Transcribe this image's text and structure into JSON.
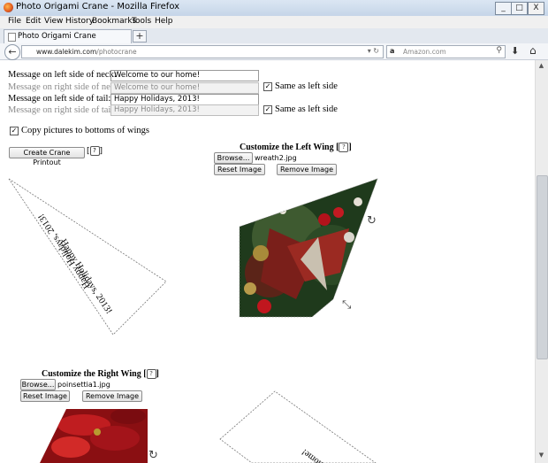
{
  "window": {
    "title": "Photo Origami Crane - Mozilla Firefox",
    "buttons": [
      "_",
      "□",
      "X"
    ]
  },
  "menu": [
    "File",
    "Edit",
    "View",
    "History",
    "Bookmarks",
    "Tools",
    "Help"
  ],
  "tab": {
    "label": "Photo Origami Crane",
    "new_tab": "+"
  },
  "nav": {
    "url_host": "www.dalekim.com",
    "url_path": "/photocrane",
    "search_placeholder": "Amazon.com"
  },
  "form": {
    "neck_left_label": "Message on left side of neck:",
    "neck_left_value": "Welcome to our home!",
    "neck_right_label": "Message on right side of neck:",
    "neck_right_value": "Welcome to our home!",
    "neck_same_label": "Same as left side",
    "tail_left_label": "Message on left side of tail:",
    "tail_left_value": "Happy Holidays, 2013!",
    "tail_right_label": "Message on right side of tail:",
    "tail_right_value": "Happy Holidays, 2013!",
    "tail_same_label": "Same as left side",
    "copy_label": "Copy pictures to bottoms of wings",
    "printout_button": "Create Crane Printout",
    "help_glyph": "?"
  },
  "left_wing": {
    "title": "Customize the Left Wing",
    "browse": "Browse...",
    "filename": "wreath2.jpg",
    "reset": "Reset Image",
    "remove": "Remove Image"
  },
  "right_wing": {
    "title": "Customize the Right Wing",
    "browse": "Browse...",
    "filename": "poinsettia1.jpg",
    "reset": "Reset Image",
    "remove": "Remove Image"
  },
  "preview": {
    "tail_text": "Happy Holidays, 2013!",
    "neck_text": "Welcome to our home!",
    "neck_text_visible": "home!"
  },
  "colors": {
    "accent_red": "#b3121b",
    "wreath_green": "#2f4a2a"
  }
}
